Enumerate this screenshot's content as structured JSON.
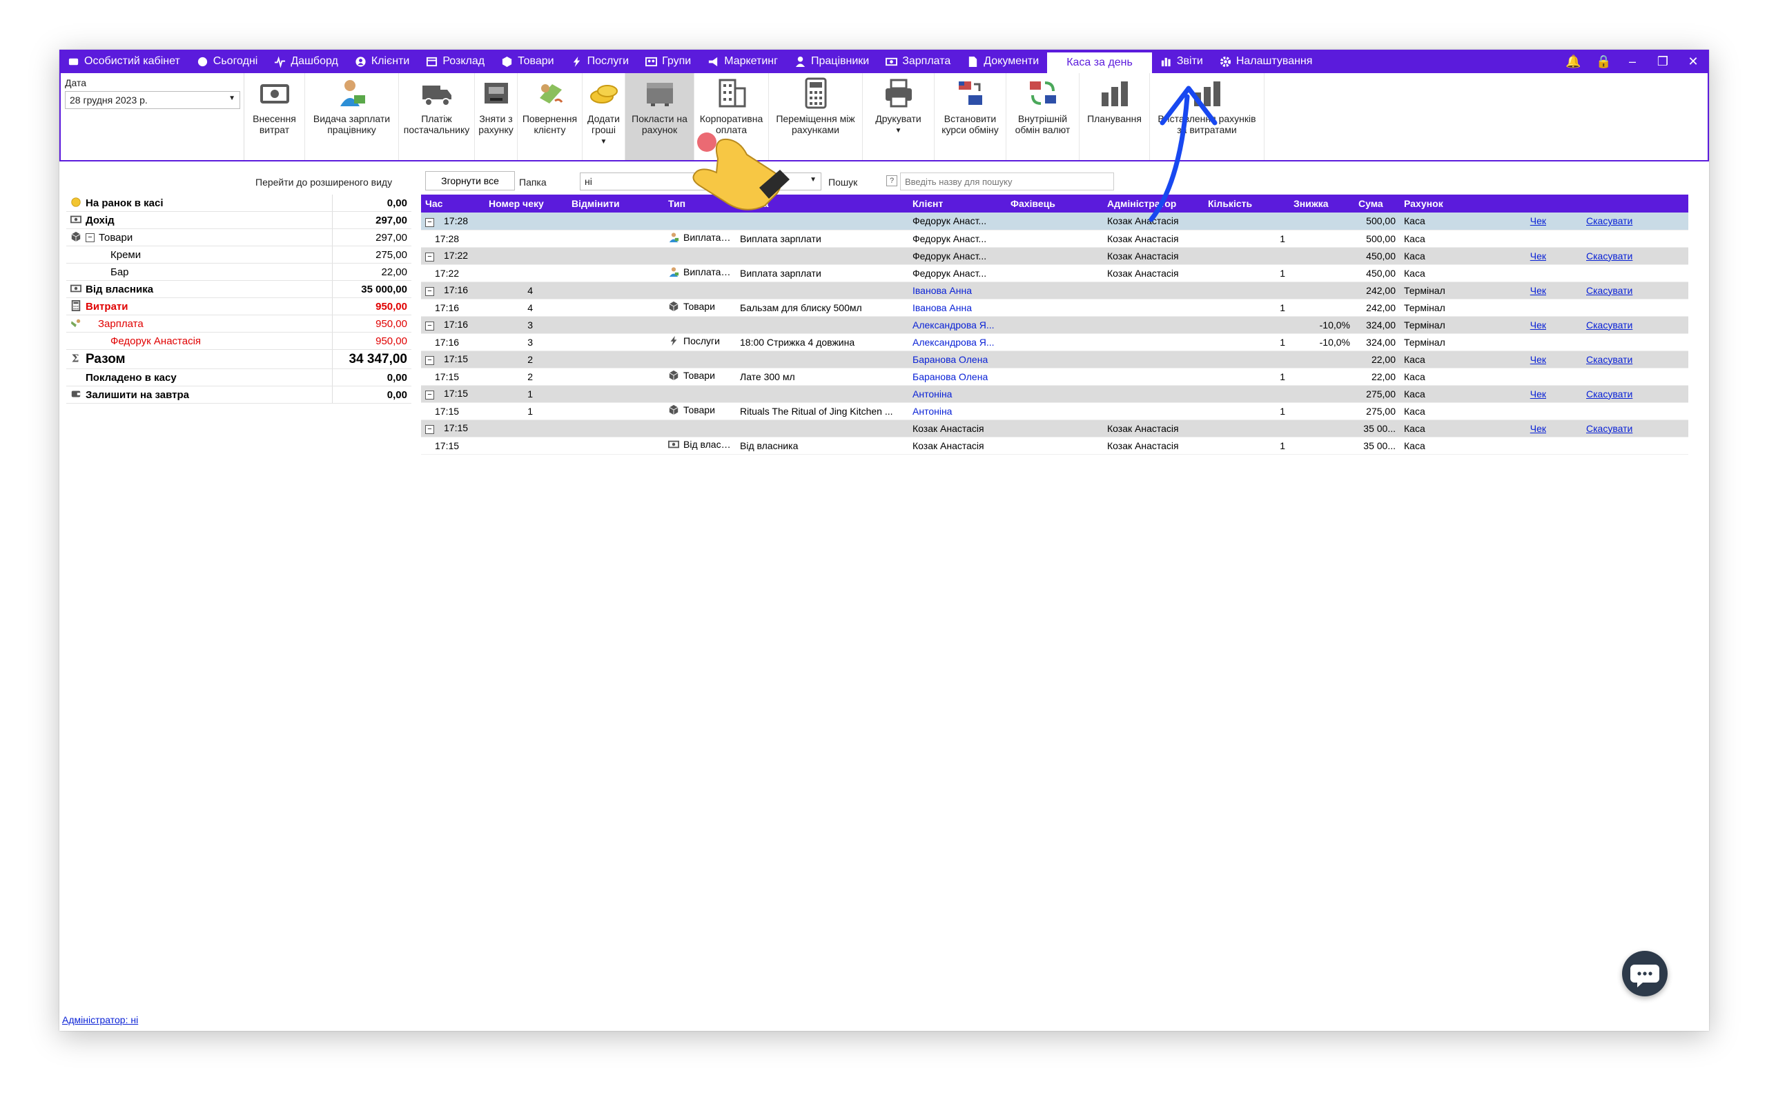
{
  "menu": {
    "items": [
      {
        "label": "Особистий кабінет",
        "icon": "wallet-icon"
      },
      {
        "label": "Сьогодні",
        "icon": "clock-icon"
      },
      {
        "label": "Дашборд",
        "icon": "pulse-icon"
      },
      {
        "label": "Клієнти",
        "icon": "user-circle-icon"
      },
      {
        "label": "Розклад",
        "icon": "calendar-icon"
      },
      {
        "label": "Товари",
        "icon": "box-icon"
      },
      {
        "label": "Послуги",
        "icon": "bolt-icon"
      },
      {
        "label": "Групи",
        "icon": "group-icon"
      },
      {
        "label": "Маркетинг",
        "icon": "megaphone-icon"
      },
      {
        "label": "Працівники",
        "icon": "person-icon"
      },
      {
        "label": "Зарплата",
        "icon": "money-icon"
      },
      {
        "label": "Документи",
        "icon": "document-icon"
      },
      {
        "label": "Каса за день",
        "icon": ""
      },
      {
        "label": "Звіти",
        "icon": "bar-chart-icon"
      },
      {
        "label": "Налаштування",
        "icon": "gear-icon"
      }
    ],
    "active_index": 12
  },
  "ribbon": {
    "date_label": "Дата",
    "date_value": "28 грудня  2023 р.",
    "buttons": [
      {
        "label": "Внесення\nвитрат",
        "icon": "cash-icon"
      },
      {
        "label": "Видача зарплати\nпрацівнику",
        "icon": "employee-pay-icon"
      },
      {
        "label": "Платіж\nпостачальнику",
        "icon": "truck-icon"
      },
      {
        "label": "Зняти з\nрахунку",
        "icon": "atm-icon"
      },
      {
        "label": "Повернення\nклієнту",
        "icon": "refund-icon"
      },
      {
        "label": "Додати\nгроші",
        "icon": "coins-icon",
        "caret": true
      },
      {
        "label": "Покласти на\nрахунок",
        "icon": "safe-icon",
        "selected": true
      },
      {
        "label": "Корпоративна\nоплата",
        "icon": "building-icon"
      },
      {
        "label": "Переміщення між\nрахунками",
        "icon": "calculator-icon"
      },
      {
        "label": "Друкувати",
        "icon": "printer-icon",
        "caret": true
      },
      {
        "label": "Встановити\nкурси обміну",
        "icon": "exchange-rate-icon"
      },
      {
        "label": "Внутрішній\nобмін валют",
        "icon": "currency-swap-icon"
      },
      {
        "label": "Планування",
        "icon": "planning-chart-icon"
      },
      {
        "label": "Виставлення рахунків\nза витратами",
        "icon": "invoice-chart-icon"
      }
    ]
  },
  "subbar": {
    "advanced_link": "Перейти до розширеного виду",
    "collapse_btn": "Згорнути все",
    "folder_label": "Папка",
    "folder_value": "ні",
    "search_label": "Пошук",
    "search_placeholder": "Введіть назву для пошуку"
  },
  "summary": [
    {
      "icon": "coin-icon",
      "name": "На ранок в касі",
      "value": "0,00",
      "style": "bold",
      "indent": 0
    },
    {
      "icon": "cash-icon",
      "name": "Дохід",
      "value": "297,00",
      "style": "bold",
      "indent": 0
    },
    {
      "icon": "box-icon",
      "name": "Товари",
      "value": "297,00",
      "style": "",
      "indent": 0,
      "expander": "⊟"
    },
    {
      "icon": "",
      "name": "Креми",
      "value": "275,00",
      "style": "",
      "indent": 2
    },
    {
      "icon": "",
      "name": "Бар",
      "value": "22,00",
      "style": "",
      "indent": 2
    },
    {
      "icon": "cash-icon",
      "name": "Від власника",
      "value": "35 000,00",
      "style": "bold",
      "indent": 0
    },
    {
      "icon": "calculator-icon",
      "name": "Витрати",
      "value": "950,00",
      "style": "bold red",
      "indent": 0
    },
    {
      "icon": "pay-icon",
      "name": "Зарплата",
      "value": "950,00",
      "style": "red",
      "indent": 1
    },
    {
      "icon": "",
      "name": "Федорук Анастасія",
      "value": "950,00",
      "style": "red",
      "indent": 2
    },
    {
      "icon": "sigma-icon",
      "name": "Разом",
      "value": "34 347,00",
      "style": "bold large",
      "indent": 0
    },
    {
      "icon": "",
      "name": "Покладено в касу",
      "value": "0,00",
      "style": "bold",
      "indent": 0
    },
    {
      "icon": "wallet-icon",
      "name": "Залишити на завтра",
      "value": "0,00",
      "style": "bold",
      "indent": 0
    }
  ],
  "table": {
    "columns": [
      "Час",
      "Номер чеку",
      "Відмінити",
      "Тип",
      "Назва",
      "Клієнт",
      "Фахівець",
      "Адміністратор",
      "Кількість",
      "Знижка",
      "Сума",
      "Рахунок",
      "",
      ""
    ],
    "rows": [
      {
        "group": true,
        "highlight": true,
        "time": "17:28",
        "receipt": "",
        "type_icon": "",
        "type": "",
        "name": "",
        "client": "Федорук Анаст...",
        "client_blue": false,
        "specialist": "",
        "admin": "Козак Анастасія",
        "qty": "",
        "discount": "",
        "sum": "500,00",
        "account": "Каса",
        "receipt_link": "Чек",
        "cancel_link": "Скасувати"
      },
      {
        "group": false,
        "time": "17:28",
        "receipt": "",
        "type_icon": "employee-icon",
        "type": "Виплата за...",
        "name": "Виплата зарплати",
        "client": "Федорук Анаст...",
        "client_blue": false,
        "specialist": "",
        "admin": "Козак Анастасія",
        "qty": "1",
        "discount": "",
        "sum": "500,00",
        "account": "Каса",
        "receipt_link": "",
        "cancel_link": ""
      },
      {
        "group": true,
        "time": "17:22",
        "receipt": "",
        "type_icon": "",
        "type": "",
        "name": "",
        "client": "Федорук Анаст...",
        "client_blue": false,
        "specialist": "",
        "admin": "Козак Анастасія",
        "qty": "",
        "discount": "",
        "sum": "450,00",
        "account": "Каса",
        "receipt_link": "Чек",
        "cancel_link": "Скасувати"
      },
      {
        "group": false,
        "time": "17:22",
        "receipt": "",
        "type_icon": "employee-icon",
        "type": "Виплата за...",
        "name": "Виплата зарплати",
        "client": "Федорук Анаст...",
        "client_blue": false,
        "specialist": "",
        "admin": "Козак Анастасія",
        "qty": "1",
        "discount": "",
        "sum": "450,00",
        "account": "Каса",
        "receipt_link": "",
        "cancel_link": ""
      },
      {
        "group": true,
        "time": "17:16",
        "receipt": "4",
        "type_icon": "",
        "type": "",
        "name": "",
        "client": "Іванова Анна",
        "client_blue": true,
        "specialist": "",
        "admin": "",
        "qty": "",
        "discount": "",
        "sum": "242,00",
        "account": "Термінал",
        "receipt_link": "Чек",
        "cancel_link": "Скасувати"
      },
      {
        "group": false,
        "time": "17:16",
        "receipt": "4",
        "type_icon": "box-icon",
        "type": "Товари",
        "name": "Бальзам для блиску 500мл",
        "client": "Іванова Анна",
        "client_blue": true,
        "specialist": "",
        "admin": "",
        "qty": "1",
        "discount": "",
        "sum": "242,00",
        "account": "Термінал",
        "receipt_link": "",
        "cancel_link": ""
      },
      {
        "group": true,
        "time": "17:16",
        "receipt": "3",
        "type_icon": "",
        "type": "",
        "name": "",
        "client": "Александрова Я...",
        "client_blue": true,
        "specialist": "",
        "admin": "",
        "qty": "",
        "discount": "-10,0%",
        "sum": "324,00",
        "account": "Термінал",
        "receipt_link": "Чек",
        "cancel_link": "Скасувати"
      },
      {
        "group": false,
        "time": "17:16",
        "receipt": "3",
        "type_icon": "bolt-icon",
        "type": "Послуги",
        "name": "18:00 Стрижка 4 довжина",
        "client": "Александрова Я...",
        "client_blue": true,
        "specialist": "",
        "admin": "",
        "qty": "1",
        "discount": "-10,0%",
        "sum": "324,00",
        "account": "Термінал",
        "receipt_link": "",
        "cancel_link": ""
      },
      {
        "group": true,
        "time": "17:15",
        "receipt": "2",
        "type_icon": "",
        "type": "",
        "name": "",
        "client": "Баранова Олена",
        "client_blue": true,
        "specialist": "",
        "admin": "",
        "qty": "",
        "discount": "",
        "sum": "22,00",
        "account": "Каса",
        "receipt_link": "Чек",
        "cancel_link": "Скасувати"
      },
      {
        "group": false,
        "time": "17:15",
        "receipt": "2",
        "type_icon": "box-icon",
        "type": "Товари",
        "name": "Лате 300 мл",
        "client": "Баранова Олена",
        "client_blue": true,
        "specialist": "",
        "admin": "",
        "qty": "1",
        "discount": "",
        "sum": "22,00",
        "account": "Каса",
        "receipt_link": "",
        "cancel_link": ""
      },
      {
        "group": true,
        "time": "17:15",
        "receipt": "1",
        "type_icon": "",
        "type": "",
        "name": "",
        "client": "Антоніна",
        "client_blue": true,
        "specialist": "",
        "admin": "",
        "qty": "",
        "discount": "",
        "sum": "275,00",
        "account": "Каса",
        "receipt_link": "Чек",
        "cancel_link": "Скасувати"
      },
      {
        "group": false,
        "time": "17:15",
        "receipt": "1",
        "type_icon": "box-icon",
        "type": "Товари",
        "name": "Rituals The Ritual of Jing Kitchen ...",
        "client": "Антоніна",
        "client_blue": true,
        "specialist": "",
        "admin": "",
        "qty": "1",
        "discount": "",
        "sum": "275,00",
        "account": "Каса",
        "receipt_link": "",
        "cancel_link": ""
      },
      {
        "group": true,
        "time": "17:15",
        "receipt": "",
        "type_icon": "",
        "type": "",
        "name": "",
        "client": "Козак Анастасія",
        "client_blue": false,
        "specialist": "",
        "admin": "Козак Анастасія",
        "qty": "",
        "discount": "",
        "sum": "35 00...",
        "account": "Каса",
        "receipt_link": "Чек",
        "cancel_link": "Скасувати"
      },
      {
        "group": false,
        "time": "17:15",
        "receipt": "",
        "type_icon": "cash-icon",
        "type": "Від власника",
        "name": "Від власника",
        "client": "Козак Анастасія",
        "client_blue": false,
        "specialist": "",
        "admin": "Козак Анастасія",
        "qty": "1",
        "discount": "",
        "sum": "35 00...",
        "account": "Каса",
        "receipt_link": "",
        "cancel_link": ""
      }
    ]
  },
  "footer": {
    "admin_link": "Адміністратор: ні"
  },
  "colors": {
    "accent": "#5b1bdc",
    "link": "#0a22d6",
    "expense": "#e00000",
    "group_row": "#dcdcdc",
    "highlight_row": "#c9dbe6"
  }
}
